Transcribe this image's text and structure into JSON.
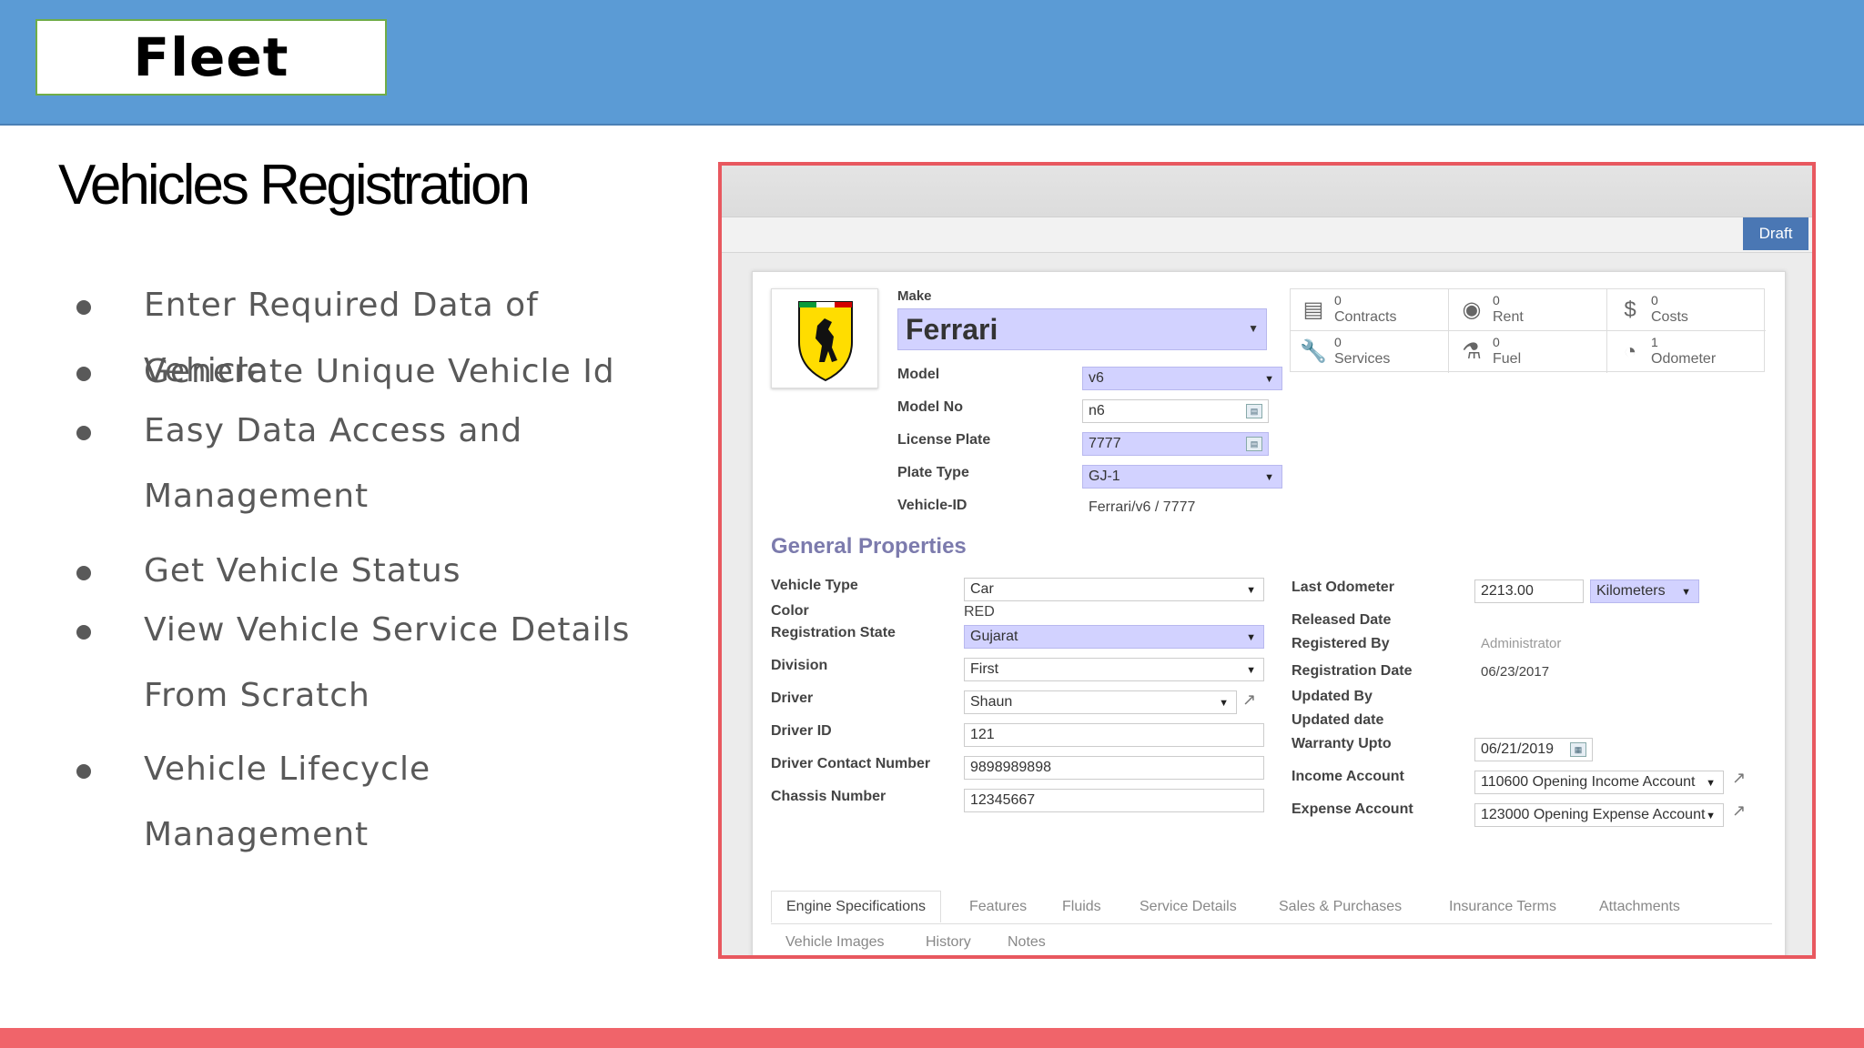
{
  "slide": {
    "header": "Fleet",
    "title": "Vehicles Registration",
    "bullets": [
      "Enter Required Data of Vehicle",
      "Generate Unique Vehicle Id",
      "Easy Data Access and Management",
      "Get Vehicle Status",
      "View Vehicle Service Details From Scratch",
      "Vehicle Lifecycle Management"
    ],
    "bullet_lines": {
      "b3_line1": "Easy Data Access and",
      "b3_line2": "Management",
      "b5_line1": "View Vehicle Service Details",
      "b5_line2": "From Scratch"
    }
  },
  "form": {
    "status": "Draft",
    "make_label": "Make",
    "make_value": "Ferrari",
    "logo_icon": "ferrari-logo",
    "fields_top": [
      {
        "label": "Model",
        "value": "v6"
      },
      {
        "label": "Model No",
        "value": "n6"
      },
      {
        "label": "License Plate",
        "value": "7777"
      },
      {
        "label": "Plate Type",
        "value": "GJ-1"
      },
      {
        "label": "Vehicle-ID",
        "value": "Ferrari/v6 / 7777"
      }
    ],
    "stats": [
      {
        "count": "0",
        "name": "Contracts",
        "icon": "book-icon"
      },
      {
        "count": "0",
        "name": "Rent",
        "icon": "rent-icon"
      },
      {
        "count": "0",
        "name": "Costs",
        "icon": "dollar-icon"
      },
      {
        "count": "0",
        "name": "Services",
        "icon": "wrench-icon"
      },
      {
        "count": "0",
        "name": "Fuel",
        "icon": "flask-icon"
      },
      {
        "count": "1",
        "name": "Odometer",
        "icon": "gauge-icon"
      }
    ],
    "section_title": "General Properties",
    "left_fields": [
      {
        "label": "Vehicle Type",
        "value": "Car"
      },
      {
        "label": "Color",
        "value": "RED"
      },
      {
        "label": "Registration State",
        "value": "Gujarat"
      },
      {
        "label": "Division",
        "value": "First"
      },
      {
        "label": "Driver",
        "value": "Shaun"
      },
      {
        "label": "Driver ID",
        "value": "121"
      },
      {
        "label": "Driver Contact Number",
        "value": "9898989898"
      },
      {
        "label": "Chassis Number",
        "value": "12345667"
      }
    ],
    "right_fields": [
      {
        "label": "Last Odometer",
        "value": "2213.00",
        "unit": "Kilometers"
      },
      {
        "label": "Released Date",
        "value": ""
      },
      {
        "label": "Registered By",
        "value": "Administrator"
      },
      {
        "label": "Registration Date",
        "value": "06/23/2017"
      },
      {
        "label": "Updated By",
        "value": ""
      },
      {
        "label": "Updated date",
        "value": ""
      },
      {
        "label": "Warranty Upto",
        "value": "06/21/2019"
      },
      {
        "label": "Income Account",
        "value": "110600 Opening Income Account"
      },
      {
        "label": "Expense Account",
        "value": "123000 Opening Expense Account"
      }
    ],
    "tabs": [
      "Engine Specifications",
      "Features",
      "Fluids",
      "Service Details",
      "Sales & Purchases",
      "Insurance Terms",
      "Attachments",
      "Vehicle Images",
      "History",
      "Notes"
    ],
    "colors": {
      "required_field": "#d2d2ff",
      "section": "#7c7bad",
      "draft": "#4a77b4"
    }
  }
}
